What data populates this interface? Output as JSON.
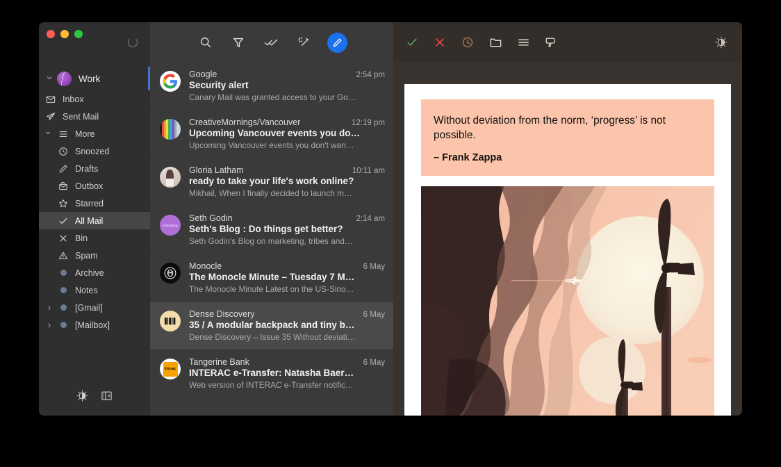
{
  "window": {
    "traffic_lights": [
      "close",
      "minimize",
      "zoom"
    ],
    "colors": {
      "sidebar_bg": "#2f2f2f",
      "list_bg": "#3a3a3a",
      "read_bg": "#39332f",
      "accent_blue": "#1b72ec",
      "selection": "#474747",
      "quote_bg": "#fcc5ab"
    }
  },
  "sidebar": {
    "account": {
      "name": "Work",
      "expanded": true
    },
    "items": [
      {
        "label": "Inbox",
        "icon": "envelope-icon",
        "level": 1,
        "selected": false
      },
      {
        "label": "Sent Mail",
        "icon": "paper-plane-icon",
        "level": 1,
        "selected": false
      },
      {
        "label": "More",
        "icon": "hamburger-icon",
        "level": 1,
        "selected": false,
        "expanded": true
      },
      {
        "label": "Snoozed",
        "icon": "clock-icon",
        "level": 2,
        "selected": false
      },
      {
        "label": "Drafts",
        "icon": "pencil-icon",
        "level": 2,
        "selected": false
      },
      {
        "label": "Outbox",
        "icon": "outbox-icon",
        "level": 2,
        "selected": false
      },
      {
        "label": "Starred",
        "icon": "star-icon",
        "level": 2,
        "selected": false
      },
      {
        "label": "All Mail",
        "icon": "check-icon",
        "level": 2,
        "selected": true
      },
      {
        "label": "Bin",
        "icon": "cross-icon",
        "level": 2,
        "selected": false
      },
      {
        "label": "Spam",
        "icon": "warning-triangle-icon",
        "level": 2,
        "selected": false
      },
      {
        "label": "Archive",
        "icon": "dot-icon",
        "level": 2,
        "selected": false
      },
      {
        "label": "Notes",
        "icon": "dot-icon",
        "level": 2,
        "selected": false
      },
      {
        "label": "[Gmail]",
        "icon": "dot-icon",
        "level": 2,
        "selected": false,
        "collapsible": true
      },
      {
        "label": "[Mailbox]",
        "icon": "dot-icon",
        "level": 2,
        "selected": false,
        "collapsible": true
      }
    ],
    "footer": [
      {
        "name": "theme-toggle-icon"
      },
      {
        "name": "collapse-sidebar-icon"
      }
    ]
  },
  "list_toolbar": {
    "buttons": [
      {
        "name": "search-icon",
        "label": "Search"
      },
      {
        "name": "filter-icon",
        "label": "Filter"
      },
      {
        "name": "mark-read-icon",
        "label": "Mark all read"
      },
      {
        "name": "magic-wand-icon",
        "label": "Clean up"
      },
      {
        "name": "compose-icon",
        "label": "Compose"
      }
    ]
  },
  "read_toolbar": {
    "buttons": [
      {
        "name": "check-icon",
        "label": "Done",
        "color": "#5eb85e"
      },
      {
        "name": "delete-icon",
        "label": "Delete",
        "color": "#e3473f"
      },
      {
        "name": "snooze-clock-icon",
        "label": "Snooze",
        "color": "#b08155"
      },
      {
        "name": "folder-icon",
        "label": "Move to folder",
        "color": "#e8e2dc"
      },
      {
        "name": "menu-icon",
        "label": "More actions",
        "color": "#e8e2dc"
      },
      {
        "name": "thumbs-down-icon",
        "label": "Block sender",
        "color": "#e8e2dc"
      }
    ],
    "right_button": {
      "name": "theme-toggle-icon",
      "label": "Theme"
    }
  },
  "mail_list": [
    {
      "sender": "Google",
      "time": "2:54 pm",
      "subject": "Security alert",
      "snippet": "Canary Mail was granted access to your Go…",
      "avatar": "google-logo",
      "selected": false
    },
    {
      "sender": "CreativeMornings/Vancouver",
      "time": "12:19 pm",
      "subject": "Upcoming Vancouver events you do…",
      "snippet": "Upcoming Vancouver events you don't wan…",
      "avatar": "rainbow-stripes",
      "selected": false
    },
    {
      "sender": "Gloria Latham",
      "time": "10:11 am",
      "subject": "ready to take your life's work online?",
      "snippet": "Mikhail, When I finally decided to launch m…",
      "avatar": "photo-portrait",
      "selected": false
    },
    {
      "sender": "Seth Godin",
      "time": "2:14 am",
      "subject": "Seth's Blog : Do things get better?",
      "snippet": "Seth Godin's Blog on marketing, tribes and…",
      "avatar": "purple-circle",
      "avatar_text": "sethsblog",
      "selected": false
    },
    {
      "sender": "Monocle",
      "time": "6 May",
      "subject": "The Monocle Minute – Tuesday 7 M…",
      "snippet": "The Monocle Minute Latest on the US-Sino…",
      "avatar": "monocle-logo",
      "selected": false
    },
    {
      "sender": "Dense Discovery",
      "time": "6 May",
      "subject": "35 / A modular backpack and tiny b…",
      "snippet": "Dense Discovery – Issue 35 Without deviati…",
      "avatar": "dense-discovery-logo",
      "selected": true
    },
    {
      "sender": "Tangerine Bank",
      "time": "6 May",
      "subject": "INTERAC e-Transfer: Natasha Baer…",
      "snippet": "Web version of INTERAC e-Transfer notific…",
      "avatar": "interac-logo",
      "selected": false
    }
  ],
  "reading": {
    "quote_text": "Without deviation from the norm, ‘progress’ is not possible.",
    "quote_attribution": "– Frank Zappa",
    "illustration_alt": "wind-turbines-sun-and-smoke-illustration"
  }
}
